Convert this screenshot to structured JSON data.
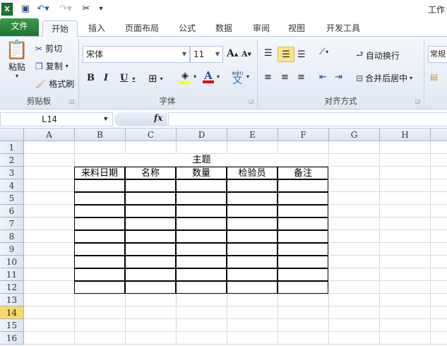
{
  "title": "工作",
  "quick_access": {
    "excel_icon": "excel-logo-icon",
    "save": "save-icon",
    "undo": "undo-icon",
    "redo": "redo-icon",
    "tools": "tools-icon",
    "customize": "customize-icon"
  },
  "tabs": [
    "文件",
    "开始",
    "插入",
    "页面布局",
    "公式",
    "数据",
    "审阅",
    "视图",
    "开发工具"
  ],
  "clipboard": {
    "paste": "粘贴",
    "cut": "剪切",
    "copy": "复制",
    "format_painter": "格式刷",
    "group": "剪贴板"
  },
  "font": {
    "name": "宋体",
    "size": "11",
    "bold": "B",
    "italic": "I",
    "underline": "U",
    "font_color": "A",
    "phonetic": "wén",
    "phonetic_char": "文",
    "group": "字体",
    "grow": "A",
    "shrink": "A",
    "fill_color": "#ffff00",
    "text_color": "#e00000"
  },
  "alignment": {
    "wrap": "自动换行",
    "merge": "合并后居中",
    "group": "对齐方式"
  },
  "number": {
    "format": "常规"
  },
  "formula_bar": {
    "name_box": "L14",
    "fx": "fx",
    "value": ""
  },
  "columns": [
    "A",
    "B",
    "C",
    "D",
    "E",
    "F",
    "G",
    "H"
  ],
  "rows": [
    "1",
    "2",
    "3",
    "4",
    "5",
    "6",
    "7",
    "8",
    "9",
    "10",
    "11",
    "12",
    "13",
    "14",
    "15",
    "16"
  ],
  "selected_row": "14",
  "sheet": {
    "title": "主题",
    "headers": [
      "来料日期",
      "名称",
      "数量",
      "检验员",
      "备注"
    ]
  },
  "accent": "#1f7431"
}
